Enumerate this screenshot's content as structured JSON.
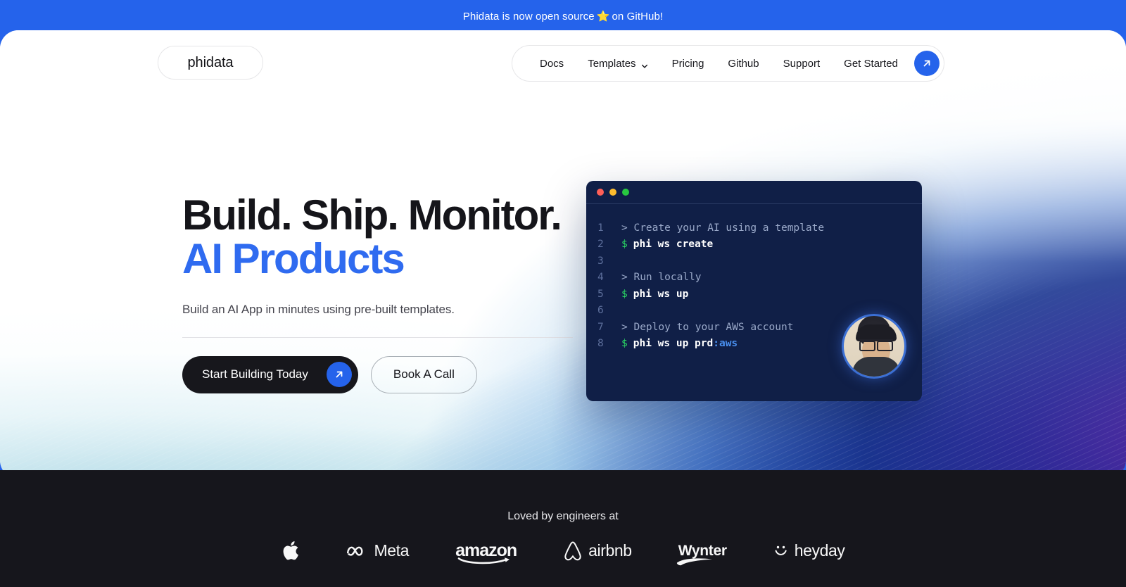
{
  "banner": {
    "text_before": "Phidata is now open source",
    "star": "⭐",
    "text_after": "on GitHub!"
  },
  "nav": {
    "logo": "phidata",
    "items": [
      {
        "label": "Docs",
        "has_chevron": false
      },
      {
        "label": "Templates",
        "has_chevron": true
      },
      {
        "label": "Pricing",
        "has_chevron": false
      },
      {
        "label": "Github",
        "has_chevron": false
      },
      {
        "label": "Support",
        "has_chevron": false
      },
      {
        "label": "Get Started",
        "has_chevron": false
      }
    ],
    "cta_icon": "arrow-up-right-icon"
  },
  "hero": {
    "heading_line1": "Build. Ship. Monitor.",
    "heading_line2": "AI Products",
    "subtitle": "Build an AI App in minutes using pre-built templates.",
    "primary_cta": "Start Building Today",
    "primary_cta_icon": "arrow-up-right-icon",
    "secondary_cta": "Book A Call"
  },
  "terminal": {
    "dots": [
      "#ff5f57",
      "#febc2e",
      "#28c840"
    ],
    "lines": [
      {
        "n": "1",
        "type": "comment",
        "text": "> Create your AI using a template"
      },
      {
        "n": "2",
        "type": "command",
        "prompt": "$",
        "text": "phi ws create"
      },
      {
        "n": "3",
        "type": "blank",
        "text": ""
      },
      {
        "n": "4",
        "type": "comment",
        "text": "> Run locally"
      },
      {
        "n": "5",
        "type": "command",
        "prompt": "$",
        "text": "phi ws up"
      },
      {
        "n": "6",
        "type": "blank",
        "text": ""
      },
      {
        "n": "7",
        "type": "comment",
        "text": "> Deploy to your AWS account"
      },
      {
        "n": "8",
        "type": "command",
        "prompt": "$",
        "text": "phi ws up prd",
        "accent": ":aws"
      }
    ]
  },
  "footer": {
    "tagline": "Loved by engineers at",
    "logos": [
      {
        "name": "apple",
        "label": ""
      },
      {
        "name": "meta",
        "label": "Meta"
      },
      {
        "name": "amazon",
        "label": "amazon"
      },
      {
        "name": "airbnb",
        "label": "airbnb"
      },
      {
        "name": "wynter",
        "label": "Wynter"
      },
      {
        "name": "heyday",
        "label": "heyday"
      }
    ]
  },
  "colors": {
    "brand_blue": "#2563eb",
    "heading_blue": "#2f6bf0",
    "dark": "#17171c",
    "footer_bg": "#16161c",
    "terminal_bg": "#101f47",
    "prompt_green": "#2bd964"
  }
}
